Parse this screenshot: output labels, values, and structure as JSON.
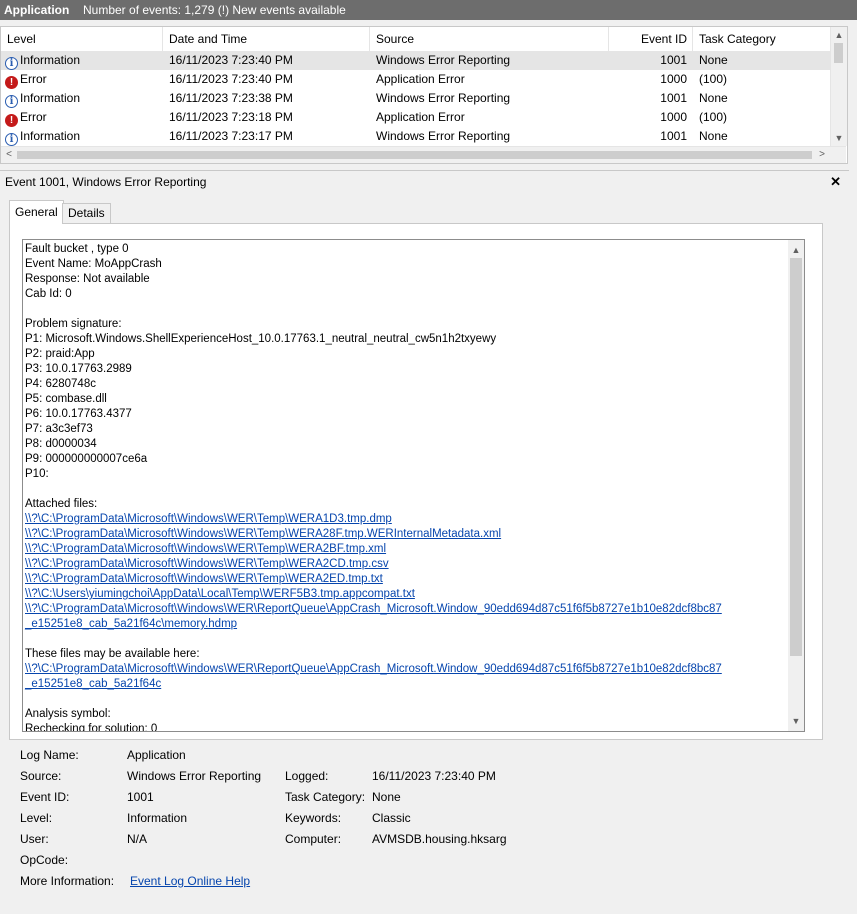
{
  "titlebar": {
    "app": "Application",
    "count": "Number of events: 1,279 (!) New events available"
  },
  "grid": {
    "columns": {
      "level": "Level",
      "datetime": "Date and Time",
      "source": "Source",
      "eventid": "Event ID",
      "category": "Task Category"
    },
    "rows": [
      {
        "level": "Information",
        "icon": "info",
        "datetime": "16/11/2023 7:23:40 PM",
        "source": "Windows Error Reporting",
        "eventid": "1001",
        "category": "None"
      },
      {
        "level": "Error",
        "icon": "error",
        "datetime": "16/11/2023 7:23:40 PM",
        "source": "Application Error",
        "eventid": "1000",
        "category": "(100)"
      },
      {
        "level": "Information",
        "icon": "info",
        "datetime": "16/11/2023 7:23:38 PM",
        "source": "Windows Error Reporting",
        "eventid": "1001",
        "category": "None"
      },
      {
        "level": "Error",
        "icon": "error",
        "datetime": "16/11/2023 7:23:18 PM",
        "source": "Application Error",
        "eventid": "1000",
        "category": "(100)"
      },
      {
        "level": "Information",
        "icon": "info",
        "datetime": "16/11/2023 7:23:17 PM",
        "source": "Windows Error Reporting",
        "eventid": "1001",
        "category": "None"
      }
    ]
  },
  "detail": {
    "title": "Event 1001, Windows Error Reporting",
    "tabs": {
      "general": "General",
      "details": "Details"
    },
    "text_lines": [
      "Fault bucket , type 0",
      "Event Name: MoAppCrash",
      "Response: Not available",
      "Cab Id: 0",
      "",
      "Problem signature:",
      "P1: Microsoft.Windows.ShellExperienceHost_10.0.17763.1_neutral_neutral_cw5n1h2txyewy",
      "P2: praid:App",
      "P3: 10.0.17763.2989",
      "P4: 6280748c",
      "P5: combase.dll",
      "P6: 10.0.17763.4377",
      "P7: a3c3ef73",
      "P8: d0000034",
      "P9: 000000000007ce6a",
      "P10:",
      "",
      "Attached files:"
    ],
    "attached_files": [
      "\\\\?\\C:\\ProgramData\\Microsoft\\Windows\\WER\\Temp\\WERA1D3.tmp.dmp",
      "\\\\?\\C:\\ProgramData\\Microsoft\\Windows\\WER\\Temp\\WERA28F.tmp.WERInternalMetadata.xml",
      "\\\\?\\C:\\ProgramData\\Microsoft\\Windows\\WER\\Temp\\WERA2BF.tmp.xml",
      "\\\\?\\C:\\ProgramData\\Microsoft\\Windows\\WER\\Temp\\WERA2CD.tmp.csv",
      "\\\\?\\C:\\ProgramData\\Microsoft\\Windows\\WER\\Temp\\WERA2ED.tmp.txt",
      "\\\\?\\C:\\Users\\yiumingchoi\\AppData\\Local\\Temp\\WERF5B3.tmp.appcompat.txt",
      "\\\\?\\C:\\ProgramData\\Microsoft\\Windows\\WER\\ReportQueue\\AppCrash_Microsoft.Window_90edd694d87c51f6f5b8727e1b10e82dcf8bc87",
      "_e15251e8_cab_5a21f64c\\memory.hdmp"
    ],
    "available_label": "These files may be available here:",
    "available_paths": [
      "\\\\?\\C:\\ProgramData\\Microsoft\\Windows\\WER\\ReportQueue\\AppCrash_Microsoft.Window_90edd694d87c51f6f5b8727e1b10e82dcf8bc87",
      "_e15251e8_cab_5a21f64c"
    ],
    "analysis_label": "Analysis symbol:",
    "rechecking": "Rechecking for solution: 0"
  },
  "props": {
    "log_name_label": "Log Name:",
    "log_name": "Application",
    "source_label": "Source:",
    "source": "Windows Error Reporting",
    "logged_label": "Logged:",
    "logged": "16/11/2023 7:23:40 PM",
    "event_id_label": "Event ID:",
    "event_id": "1001",
    "task_category_label": "Task Category:",
    "task_category": "None",
    "level_label": "Level:",
    "level": "Information",
    "keywords_label": "Keywords:",
    "keywords": "Classic",
    "user_label": "User:",
    "user": "N/A",
    "computer_label": "Computer:",
    "computer": "AVMSDB.housing.hksarg",
    "opcode_label": "OpCode:",
    "opcode": "",
    "more_info_label": "More Information:",
    "more_info_link": "Event Log Online Help"
  },
  "colors": {
    "titlebar": "#6d6d6d",
    "link": "#0645ad",
    "error_icon": "#c41a1a",
    "info_icon": "#2a5db0",
    "selected_row": "#e5e5e5"
  }
}
